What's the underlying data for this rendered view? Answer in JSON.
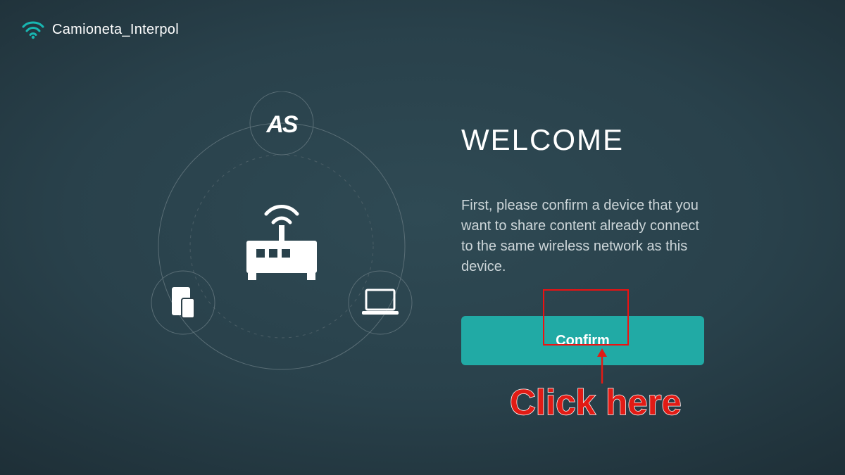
{
  "wifi": {
    "ssid": "Camioneta_Interpol"
  },
  "panel": {
    "title": "WELCOME",
    "description": "First, please confirm a device that you want to share content already connect to the same wireless network as this device.",
    "confirm_label": "Confirm"
  },
  "annotation": {
    "label": "Click here"
  },
  "colors": {
    "accent": "#21aaa5",
    "annotation_red": "#e11b15"
  }
}
